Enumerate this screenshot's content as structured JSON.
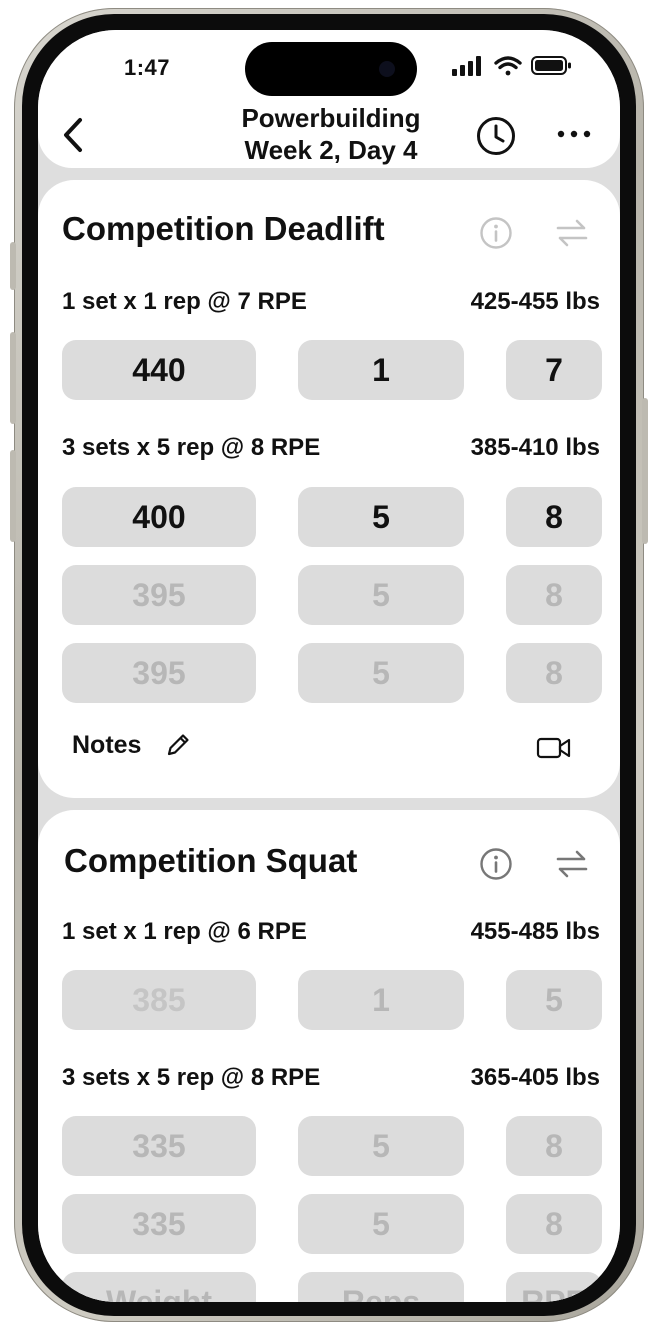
{
  "status_bar": {
    "time": "1:47"
  },
  "nav": {
    "title_line1": "Powerbuilding",
    "title_line2": "Week 2, Day 4",
    "icons": [
      "chevron-left-icon",
      "clock-icon",
      "more-icon"
    ]
  },
  "exercises": [
    {
      "name": "Competition Deadlift",
      "groups": [
        {
          "label": "1 set x 1 rep @ 7 RPE",
          "range": "425-455 lbs",
          "rows": [
            {
              "weight": "440",
              "reps": "1",
              "rpe": "7",
              "state": "filled"
            }
          ]
        },
        {
          "label": "3 sets x 5 rep @ 8 RPE",
          "range": "385-410 lbs",
          "rows": [
            {
              "weight": "400",
              "reps": "5",
              "rpe": "8",
              "state": "filled"
            },
            {
              "weight": "395",
              "reps": "5",
              "rpe": "8",
              "state": "placeholder"
            },
            {
              "weight": "395",
              "reps": "5",
              "rpe": "8",
              "state": "placeholder"
            }
          ]
        }
      ],
      "notes_label": "Notes"
    },
    {
      "name": "Competition Squat",
      "groups": [
        {
          "label": "1 set x 1 rep @ 6 RPE",
          "range": "455-485 lbs",
          "rows": [
            {
              "weight": "385",
              "reps": "1",
              "rpe": "5",
              "state": "placeholder"
            }
          ]
        },
        {
          "label": "3 sets x 5 rep @ 8 RPE",
          "range": "365-405 lbs",
          "rows": [
            {
              "weight": "335",
              "reps": "5",
              "rpe": "8",
              "state": "placeholder"
            },
            {
              "weight": "335",
              "reps": "5",
              "rpe": "8",
              "state": "placeholder"
            },
            {
              "weight": "Weight",
              "reps": "Reps",
              "rpe": "RPE",
              "state": "placeholder"
            }
          ]
        }
      ]
    }
  ],
  "colors": {
    "field_bg": "#dcdcdc",
    "placeholder_text": "#b7b7b7",
    "screen_bg": "#dedede"
  }
}
